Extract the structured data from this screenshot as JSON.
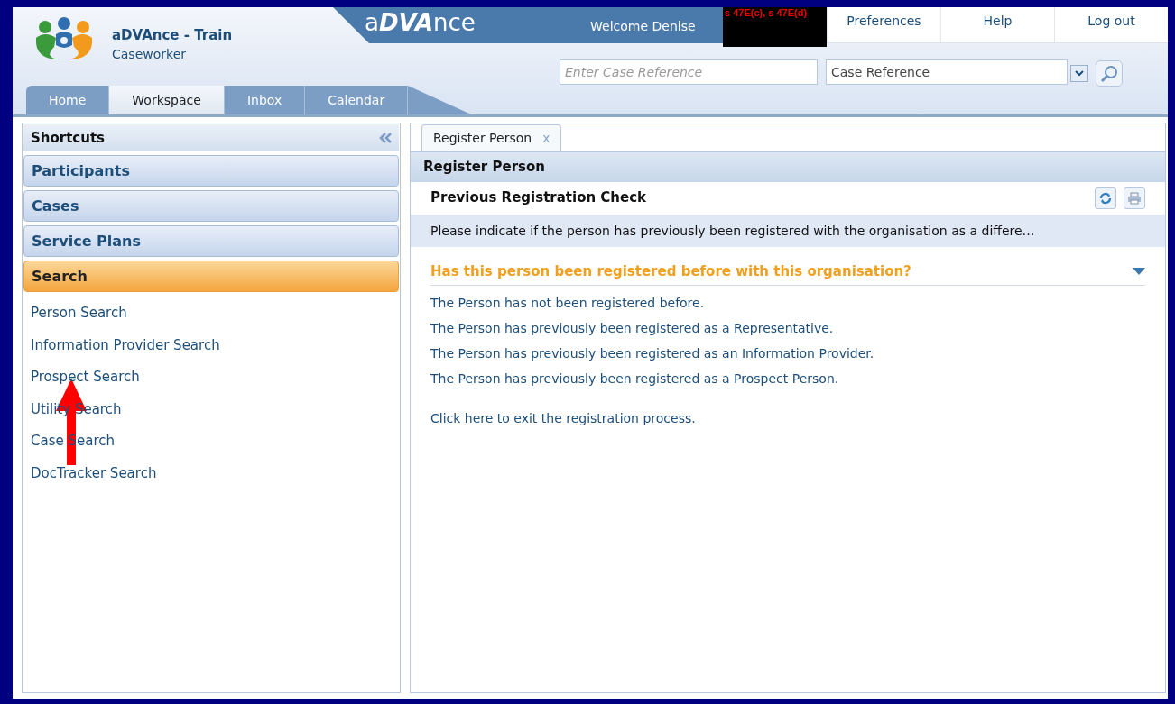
{
  "app": {
    "title": "aDVAnce - Train",
    "role": "Caseworker",
    "brand": "a**DVA**nce"
  },
  "user_bar": {
    "welcome": "Welcome Denise",
    "redaction": "s 47E(c), s 47E(d)",
    "links": [
      "Preferences",
      "Help",
      "Log out"
    ]
  },
  "case_search": {
    "placeholder": "Enter Case Reference",
    "type_value": "Case Reference"
  },
  "tabs": [
    {
      "label": "Home",
      "selected": false
    },
    {
      "label": "Workspace",
      "selected": true
    },
    {
      "label": "Inbox",
      "selected": false
    },
    {
      "label": "Calendar",
      "selected": false
    }
  ],
  "sidebar": {
    "title": "Shortcuts",
    "sections": [
      {
        "label": "Participants",
        "selected": false
      },
      {
        "label": "Cases",
        "selected": false
      },
      {
        "label": "Service Plans",
        "selected": false
      },
      {
        "label": "Search",
        "selected": true
      }
    ],
    "items": [
      "Person Search",
      "Information Provider Search",
      "Prospect Search",
      "Utility Search",
      "Case Search",
      "DocTracker Search"
    ]
  },
  "document_tabs": [
    {
      "label": "Register Person",
      "close": "x",
      "selected": true
    }
  ],
  "page": {
    "title": "Register Person",
    "section": "Previous Registration Check",
    "instruction": "Please indicate if the person has previously been registered with the organisation as a differe…",
    "question": "Has this person been registered before with this organisation?",
    "options": [
      "The Person has not been registered before.",
      "The Person has previously been registered as a Representative.",
      "The Person has previously been registered as an Information Provider.",
      "The Person has previously been registered as a Prospect Person."
    ],
    "exit_link": "Click here to exit the registration process."
  }
}
